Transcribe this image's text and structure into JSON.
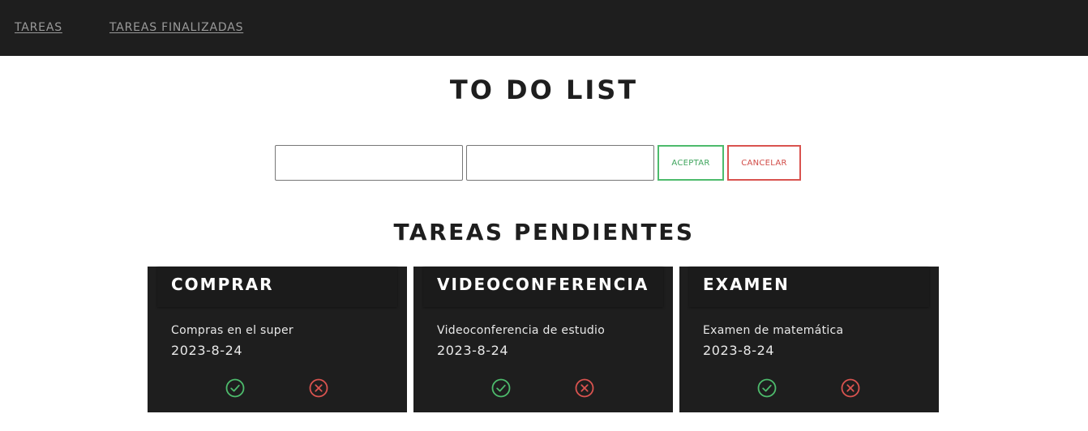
{
  "nav": {
    "links": [
      "TAREAS",
      "TAREAS FINALIZADAS"
    ]
  },
  "header": {
    "title": "TO DO LIST"
  },
  "form": {
    "title_value": "",
    "description_value": "",
    "accept_label": "ACEPTAR",
    "cancel_label": "CANCELAR"
  },
  "pending": {
    "title": "TAREAS PENDIENTES",
    "tasks": [
      {
        "title": "COMPRAR",
        "description": "Compras en el super",
        "date": "2023-8-24"
      },
      {
        "title": "VIDEOCONFERENCIA",
        "description": "Videoconferencia de estudio",
        "date": "2023-8-24"
      },
      {
        "title": "EXAMEN",
        "description": "Examen de matemática",
        "date": "2023-8-24"
      }
    ]
  },
  "colors": {
    "nav_bg": "#1e1e1e",
    "card_bg": "#1e1e1e",
    "accept": "#4dbb6c",
    "cancel": "#d9534f"
  },
  "icons": {
    "complete": "check-circle-icon",
    "delete": "x-circle-icon"
  }
}
